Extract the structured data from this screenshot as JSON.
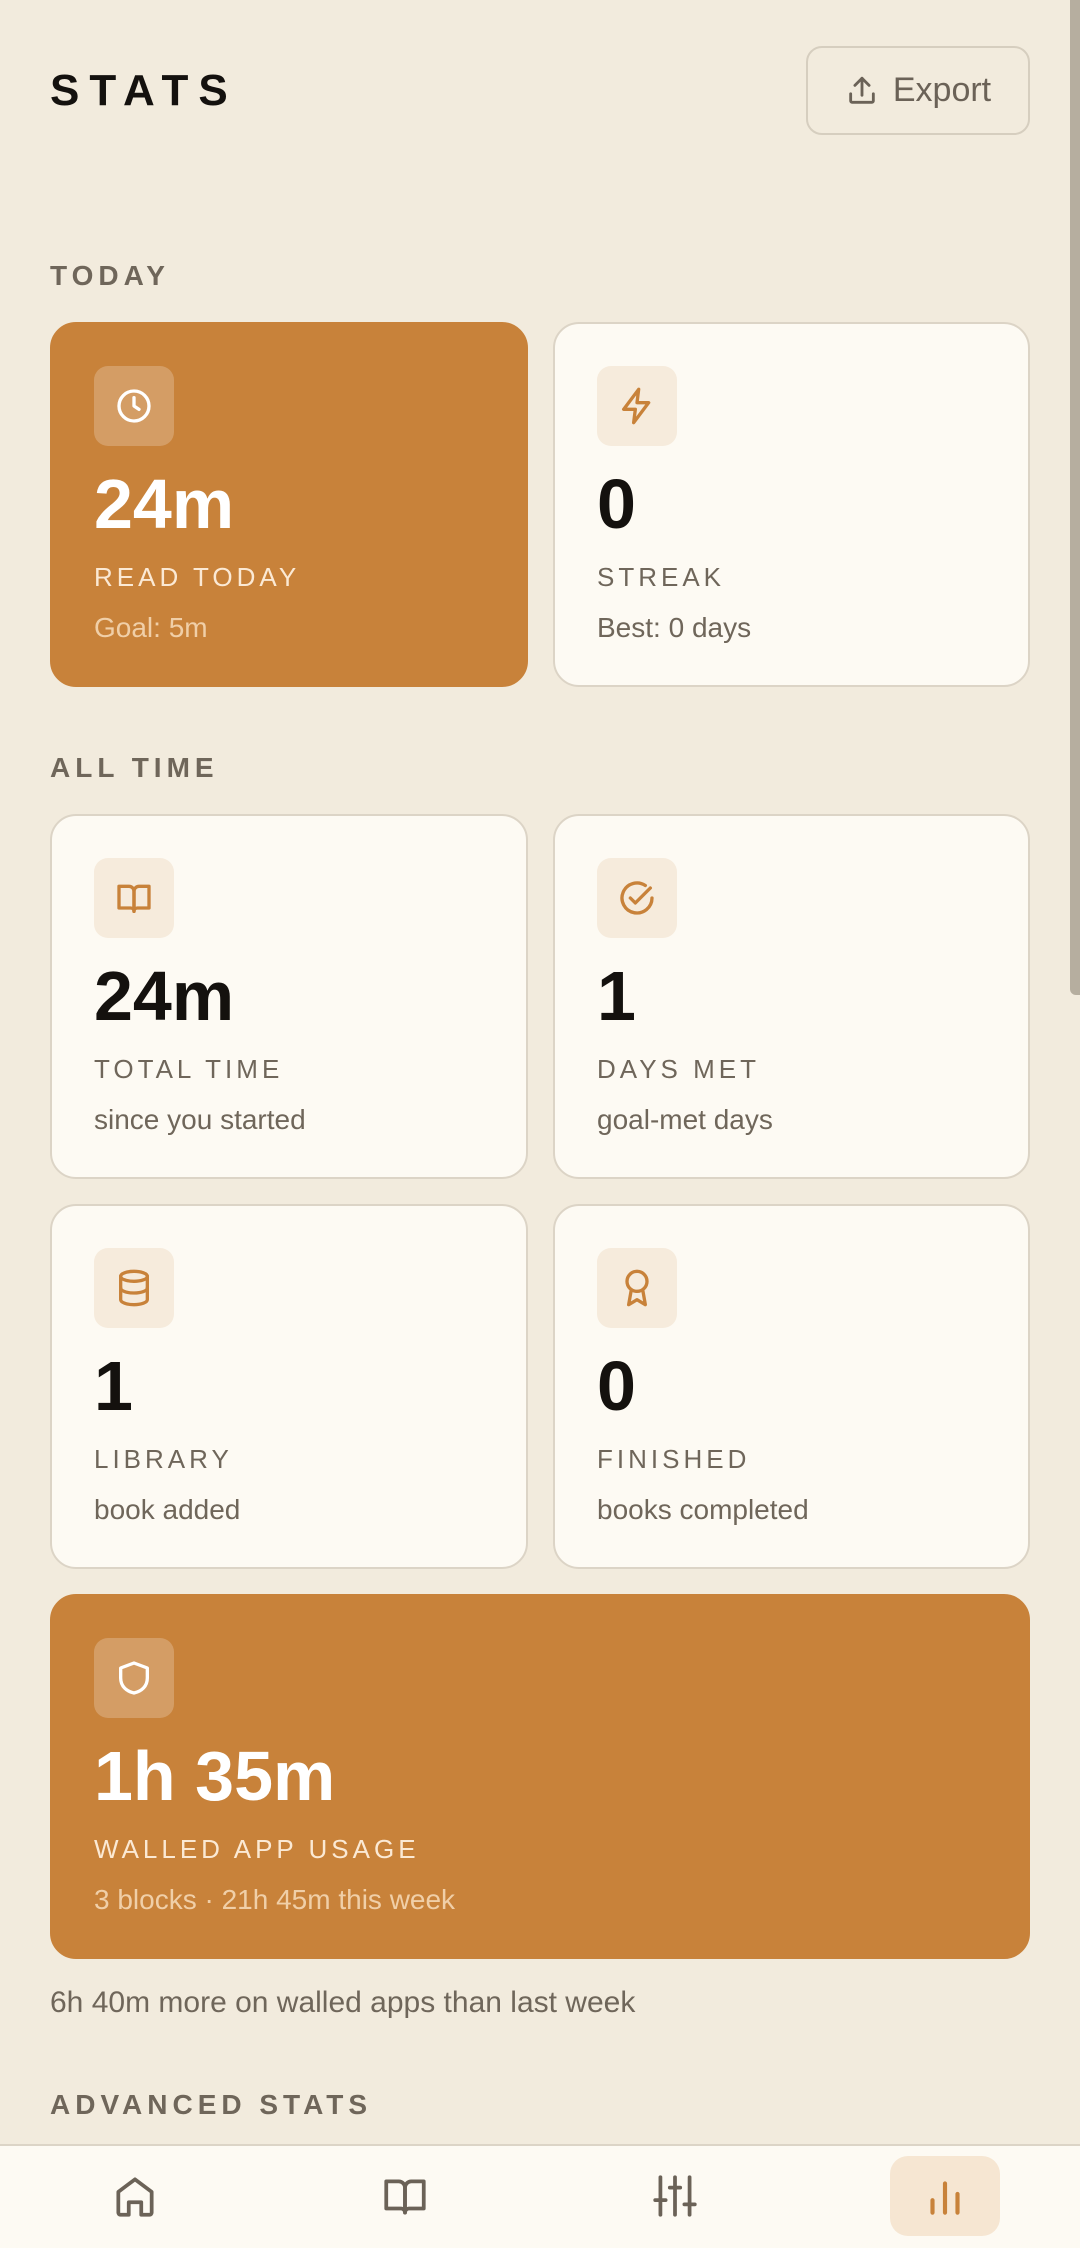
{
  "header": {
    "title": "STATS",
    "export_label": "Export"
  },
  "sections": {
    "today": "TODAY",
    "all_time": "ALL TIME",
    "advanced": "ADVANCED STATS"
  },
  "today_cards": {
    "read_today": {
      "value": "24m",
      "label": "READ TODAY",
      "sub": "Goal: 5m",
      "icon": "clock-icon"
    },
    "streak": {
      "value": "0",
      "label": "STREAK",
      "sub": "Best: 0 days",
      "icon": "lightning-icon"
    }
  },
  "all_time_cards": {
    "total_time": {
      "value": "24m",
      "label": "TOTAL TIME",
      "sub": "since you started",
      "icon": "book-open-icon"
    },
    "days_met": {
      "value": "1",
      "label": "DAYS MET",
      "sub": "goal-met days",
      "icon": "check-circle-icon"
    },
    "library": {
      "value": "1",
      "label": "LIBRARY",
      "sub": "book added",
      "icon": "database-icon"
    },
    "finished": {
      "value": "0",
      "label": "FINISHED",
      "sub": "books completed",
      "icon": "award-icon"
    }
  },
  "walled_card": {
    "value": "1h 35m",
    "label": "WALLED APP USAGE",
    "sub": "3 blocks · 21h 45m this week",
    "icon": "shield-icon"
  },
  "note": "6h 40m more on walled apps than last week",
  "nav": [
    {
      "name": "home",
      "icon": "home-icon"
    },
    {
      "name": "library",
      "icon": "book-open-icon"
    },
    {
      "name": "settings",
      "icon": "sliders-icon"
    },
    {
      "name": "stats",
      "icon": "bar-chart-icon",
      "active": true
    }
  ],
  "colors": {
    "background": "#f2ebdd",
    "accent": "#c8823a",
    "card": "#fdfaf3",
    "text": "#14110e",
    "muted": "#6f665a"
  }
}
